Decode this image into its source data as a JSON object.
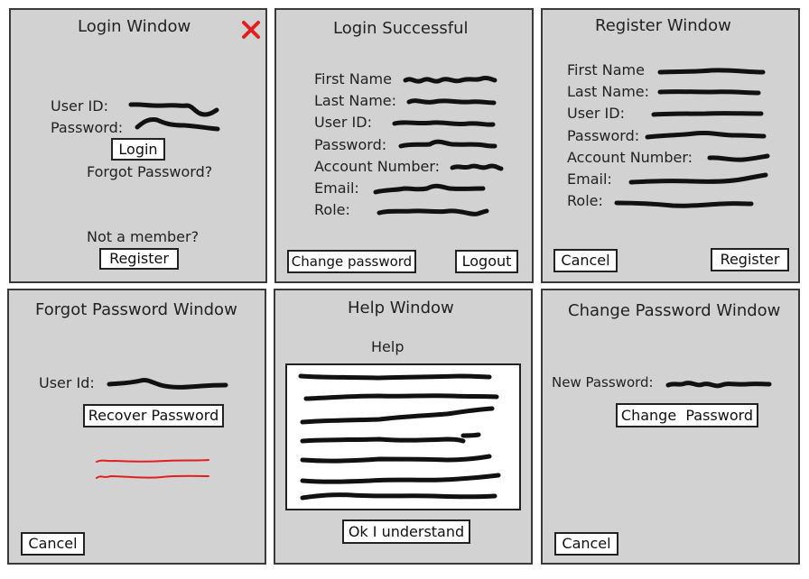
{
  "login": {
    "title": "Login Window",
    "close_icon": "close-x-icon",
    "user_id_label": "User ID:",
    "password_label": "Password:",
    "login_button": "Login",
    "forgot_link": "Forgot Password?",
    "not_member": "Not a member?",
    "register_button": "Register"
  },
  "success": {
    "title": "Login Successful",
    "fields": [
      "First Name",
      "Last Name:",
      "User ID:",
      "Password:",
      "Account Number:",
      "Email:",
      "Role:"
    ],
    "change_password_button": "Change password",
    "logout_button": "Logout"
  },
  "register": {
    "title": "Register Window",
    "fields": [
      "First Name",
      "Last Name:",
      "User ID:",
      "Password:",
      "Account Number:",
      "Email:",
      "Role:"
    ],
    "cancel_button": "Cancel",
    "register_button": "Register"
  },
  "forgot": {
    "title": "Forgot Password Window",
    "user_id_label": "User Id:",
    "recover_button": "Recover Password",
    "cancel_button": "Cancel"
  },
  "help": {
    "title": "Help Window",
    "subtitle": "Help",
    "ok_button": "Ok I understand"
  },
  "change": {
    "title": "Change Password Window",
    "new_password_label": "New Password:",
    "change_button": "Change  Password",
    "cancel_button": "Cancel"
  },
  "colors": {
    "panel_bg": "#d2d2d2",
    "close_icon": "#e02020",
    "error_scribble": "#e02020"
  }
}
